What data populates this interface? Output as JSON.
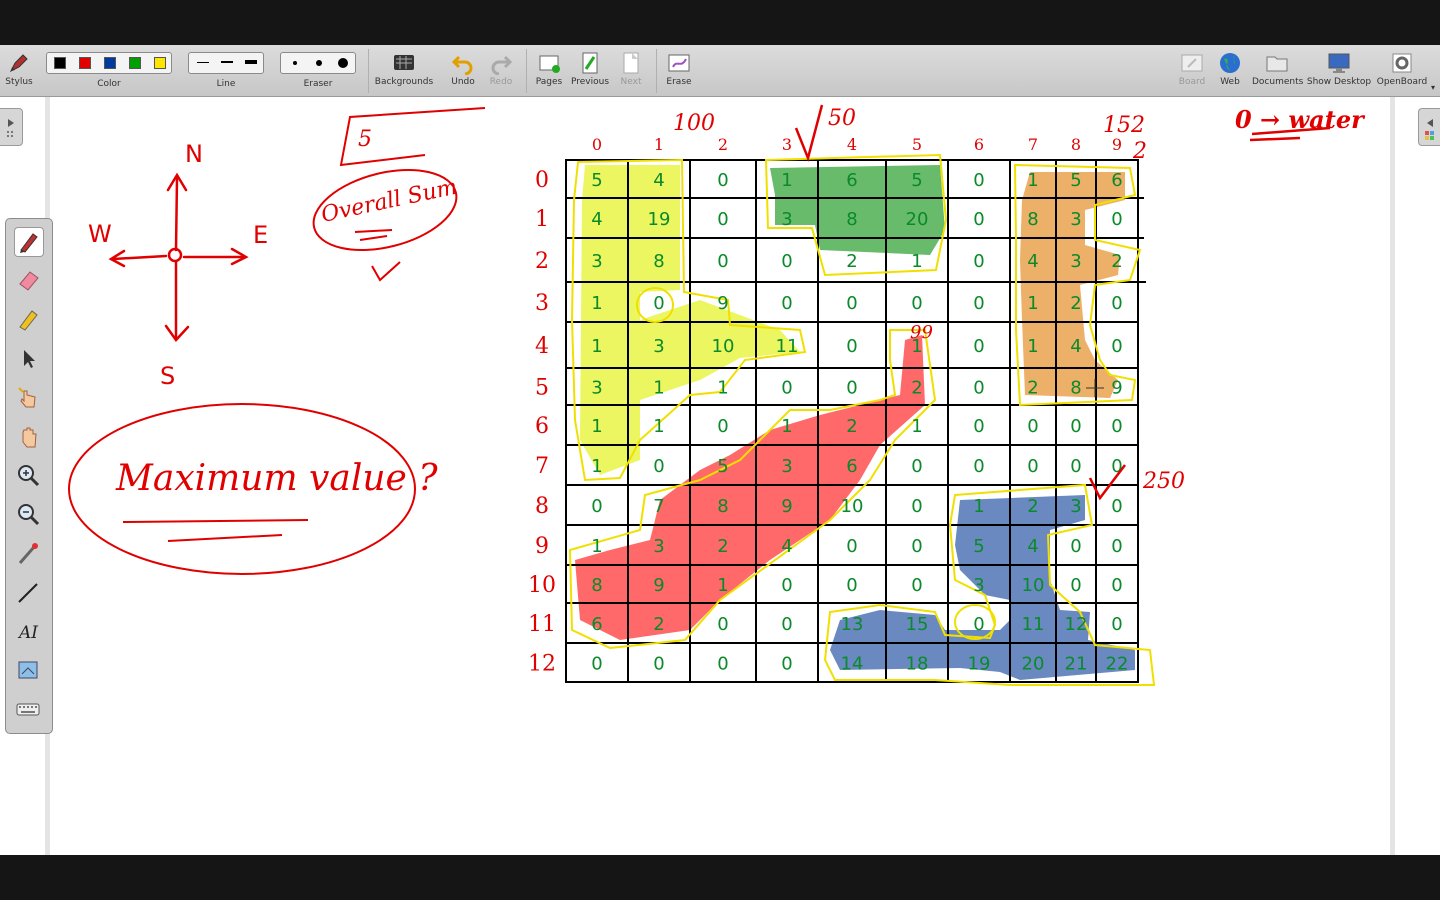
{
  "toolbar": {
    "stylus": "Stylus",
    "color": "Color",
    "line": "Line",
    "eraser": "Eraser",
    "backgrounds": "Backgrounds",
    "undo": "Undo",
    "redo": "Redo",
    "pages": "Pages",
    "previous": "Previous",
    "next": "Next",
    "erase": "Erase",
    "board": "Board",
    "web": "Web",
    "documents": "Documents",
    "show_desktop": "Show Desktop",
    "openboard": "OpenBoard"
  },
  "colors": [
    "#000000",
    "#e00000",
    "#003a9e",
    "#00a000",
    "#ffe600"
  ],
  "palette_tools": [
    "pen-icon",
    "eraser-icon",
    "highlighter-icon",
    "selector-icon",
    "interactor-icon",
    "hand-icon",
    "zoom-in-icon",
    "zoom-out-icon",
    "laser-pointer-icon",
    "line-icon",
    "text-icon",
    "capture-icon",
    "keyboard-icon"
  ],
  "board": {
    "compass": {
      "n": "N",
      "s": "S",
      "e": "E",
      "w": "W"
    },
    "notes": {
      "five": "5",
      "overall": "Overall Sum",
      "question": "Maximum value ?",
      "hundred": "100",
      "fifty": "50",
      "one52": "152",
      "two": "2",
      "two50": "250",
      "ninetynine": "99",
      "zero_water": "0 → water"
    },
    "col_labels": [
      "0",
      "1",
      "2",
      "3",
      "4",
      "5",
      "6",
      "7",
      "8",
      "9"
    ],
    "row_labels": [
      "0",
      "1",
      "2",
      "3",
      "4",
      "5",
      "6",
      "7",
      "8",
      "9",
      "10",
      "11",
      "12"
    ],
    "grid": [
      [
        "5",
        "4",
        "0",
        "1",
        "6",
        "5",
        "0",
        "1",
        "5",
        "6"
      ],
      [
        "4",
        "19",
        "0",
        "3",
        "8",
        "20",
        "0",
        "8",
        "3",
        "0"
      ],
      [
        "3",
        "8",
        "0",
        "0",
        "2",
        "1",
        "0",
        "4",
        "3",
        "2"
      ],
      [
        "1",
        "0",
        "9",
        "0",
        "0",
        "0",
        "0",
        "1",
        "2",
        "0"
      ],
      [
        "1",
        "3",
        "10",
        "11",
        "0",
        "1",
        "0",
        "1",
        "4",
        "0"
      ],
      [
        "3",
        "1",
        "1",
        "0",
        "0",
        "2",
        "0",
        "2",
        "8",
        "9"
      ],
      [
        "1",
        "1",
        "0",
        "1",
        "2",
        "1",
        "0",
        "0",
        "0",
        "0"
      ],
      [
        "1",
        "0",
        "5",
        "3",
        "6",
        "0",
        "0",
        "0",
        "0",
        "0"
      ],
      [
        "0",
        "7",
        "8",
        "9",
        "10",
        "0",
        "1",
        "2",
        "3",
        "0"
      ],
      [
        "1",
        "3",
        "2",
        "4",
        "0",
        "0",
        "5",
        "4",
        "0",
        "0"
      ],
      [
        "8",
        "9",
        "1",
        "0",
        "0",
        "0",
        "3",
        "10",
        "0",
        "0"
      ],
      [
        "6",
        "2",
        "0",
        "0",
        "13",
        "15",
        "0",
        "11",
        "12",
        "0"
      ],
      [
        "0",
        "0",
        "0",
        "0",
        "14",
        "18",
        "19",
        "20",
        "21",
        "22"
      ]
    ]
  }
}
